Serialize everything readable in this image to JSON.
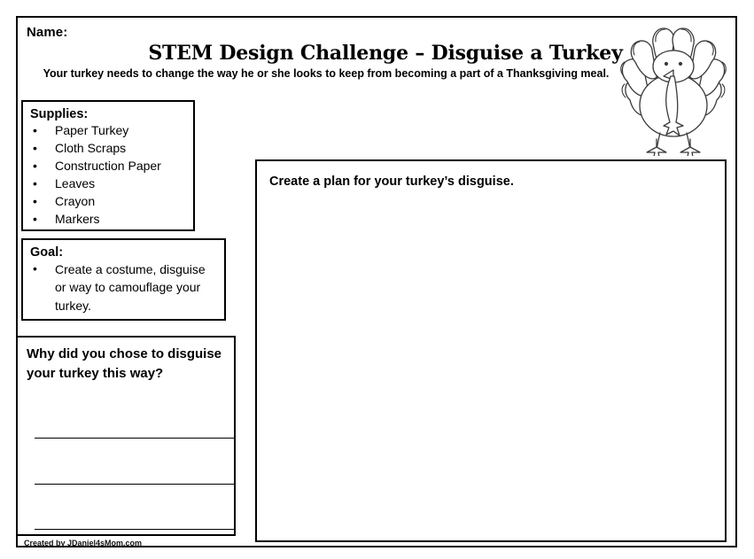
{
  "page": {
    "name_label": "Name:",
    "title": "STEM Design Challenge – Disguise a Turkey",
    "subtitle": "Your turkey needs to change the way he or she looks to keep from becoming a part of a Thanksgiving meal.",
    "credit": "Created by JDaniel4sMom.com",
    "border_color": "#000000",
    "background_color": "#ffffff",
    "text_color": "#000000"
  },
  "supplies": {
    "heading": "Supplies:",
    "bullet_glyph": "•",
    "items": [
      "Paper Turkey",
      "Cloth Scraps",
      "Construction Paper",
      "Leaves",
      "Crayon",
      "Markers"
    ]
  },
  "goal": {
    "heading": "Goal:",
    "bullet_glyph": "•",
    "items": [
      "Create a costume, disguise or way to camouflage your turkey."
    ]
  },
  "why": {
    "heading": "Why did you chose to disguise your turkey this way?",
    "lines": [
      "",
      "",
      ""
    ]
  },
  "plan": {
    "heading": "Create a plan for your turkey’s disguise."
  },
  "illustration": {
    "name": "turkey-illustration",
    "stroke_color": "#3a3a3a",
    "fill_color": "#ffffff"
  }
}
